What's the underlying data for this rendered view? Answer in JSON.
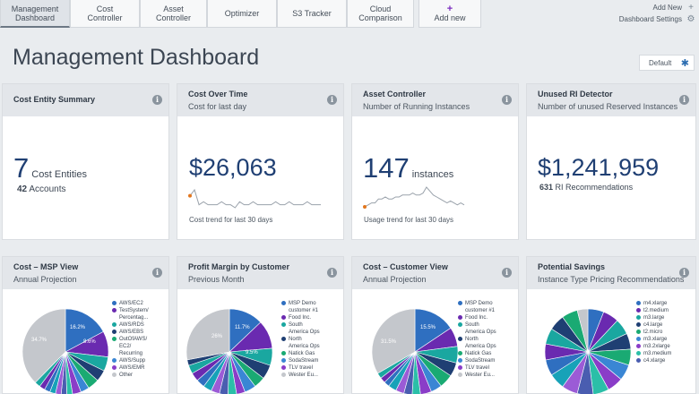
{
  "tabs": [
    {
      "label": "Management\nDashboard",
      "active": true
    },
    {
      "label": "Cost\nController"
    },
    {
      "label": "Asset\nController"
    },
    {
      "label": "Optimizer"
    },
    {
      "label": "S3 Tracker"
    },
    {
      "label": "Cloud\nComparison"
    },
    {
      "label": "Add new"
    }
  ],
  "top_right": {
    "add_new": "Add New",
    "settings": "Dashboard Settings"
  },
  "page_title": "Management Dashboard",
  "default_button": "Default",
  "cards": {
    "cost_entity": {
      "title": "Cost Entity Summary",
      "value": "7",
      "unit": "Cost Entities",
      "sub_value": "42",
      "sub_label": "Accounts"
    },
    "cost_over_time": {
      "title": "Cost Over Time",
      "subtitle": "Cost for last day",
      "value": "$26,063",
      "trend": "Cost trend for last 30 days",
      "spark": [
        5,
        7,
        2,
        3,
        2,
        2,
        2,
        3,
        2,
        2,
        1,
        3,
        2,
        2,
        3,
        2,
        2,
        2,
        2,
        3,
        2,
        2,
        3,
        2,
        2,
        2,
        3,
        2,
        2,
        2
      ]
    },
    "asset_controller": {
      "title": "Asset Controller",
      "subtitle": "Number of Running Instances",
      "value": "147",
      "unit": "instances",
      "trend": "Usage trend for last 30 days",
      "spark": [
        2,
        3,
        4,
        4,
        6,
        6,
        7,
        6,
        6,
        7,
        7,
        8,
        8,
        8,
        9,
        8,
        8,
        9,
        12,
        10,
        8,
        7,
        6,
        5,
        4,
        5,
        4,
        3,
        4,
        3
      ]
    },
    "unused_ri": {
      "title": "Unused RI Detector",
      "subtitle": "Number of unused Reserved Instances",
      "value": "$1,241,959",
      "sub_value": "631",
      "sub_label": "RI Recommendations"
    },
    "msp": {
      "title": "Cost – MSP View",
      "subtitle": "Annual Projection",
      "legend": [
        "AWS/EC2",
        "TestSystem/\nPercentag...",
        "AWS/RDS",
        "AWS/EBS",
        "OutOfAWS/\nEC2/\nRecurring",
        "AWS/Supp",
        "AWS/EMR",
        "Other"
      ],
      "labels": [
        "16.2%",
        "8.6%",
        "34.7%"
      ]
    },
    "profit": {
      "title": "Profit Margin by Customer",
      "subtitle": "Previous Month",
      "legend": [
        "MSP Demo\ncustomer #1",
        "Food Inc.",
        "South\nAmerica Ops",
        "North\nAmerica Ops",
        "Natick Gas",
        "SodaStream",
        "TLV travel",
        "Wester Eu..."
      ],
      "labels": [
        "11.7%",
        "9.5%",
        "26%"
      ]
    },
    "customer": {
      "title": "Cost – Customer View",
      "subtitle": "Annual Projection",
      "legend": [
        "MSP Demo\ncustomer #1",
        "Food Inc.",
        "South\nAmerica Ops",
        "North\nAmerica Ops",
        "Natick Gas",
        "SodaStream",
        "TLV travel",
        "Wester Eu..."
      ],
      "labels": [
        "15.5%",
        "31.5%"
      ]
    },
    "savings": {
      "title": "Potential Savings",
      "subtitle": "Instance Type Pricing Recommendations",
      "legend": [
        "m4.xlarge",
        "t2.medium",
        "m3.large",
        "c4.large",
        "t2.micro",
        "m3.xlarge",
        "m3.2xlarge",
        "m3.medium",
        "c4.xlarge"
      ]
    }
  },
  "colors": {
    "navy": "#1f3f73",
    "orange": "#e2761d",
    "blue": "#2f6fc0",
    "purple": "#6a2ab0",
    "teal": "#1aa7a0",
    "green": "#1aaa73",
    "gray": "#c4c7cc"
  }
}
